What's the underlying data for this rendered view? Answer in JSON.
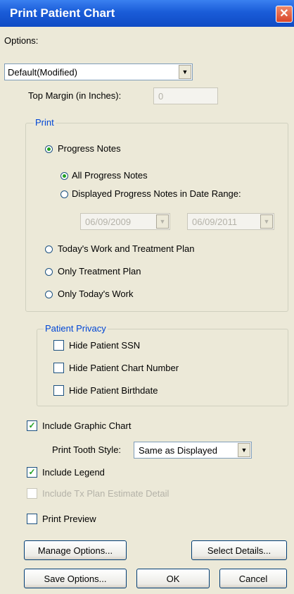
{
  "window": {
    "title": "Print Patient Chart",
    "close_glyph": "✕"
  },
  "options": {
    "label": "Options:",
    "selected": "Default(Modified)",
    "top_margin_label": "Top Margin (in Inches):",
    "top_margin_value": "0"
  },
  "print_group": {
    "label": "Print",
    "progress_notes": "Progress Notes",
    "all_progress_notes": "All Progress Notes",
    "displayed_in_range": "Displayed Progress Notes in Date Range:",
    "date_from": "06/09/2009",
    "date_to": "06/09/2011",
    "todays_work_and_plan": "Today's Work and Treatment Plan",
    "only_treatment_plan": "Only Treatment Plan",
    "only_todays_work": "Only Today's Work"
  },
  "privacy_group": {
    "label": "Patient Privacy",
    "hide_ssn": "Hide Patient SSN",
    "hide_chart_number": "Hide Patient Chart Number",
    "hide_birthdate": "Hide Patient Birthdate"
  },
  "chart_options": {
    "include_graphic_chart": "Include Graphic Chart",
    "print_tooth_style_label": "Print Tooth Style:",
    "print_tooth_style_value": "Same as Displayed",
    "include_legend": "Include Legend",
    "include_tx_plan_estimate": "Include Tx Plan Estimate Detail",
    "print_preview": "Print Preview"
  },
  "buttons": {
    "manage_options": "Manage Options...",
    "select_details": "Select Details...",
    "save_options": "Save Options...",
    "ok": "OK",
    "cancel": "Cancel"
  },
  "glyphs": {
    "check": "✓",
    "dropdown": "▼"
  }
}
